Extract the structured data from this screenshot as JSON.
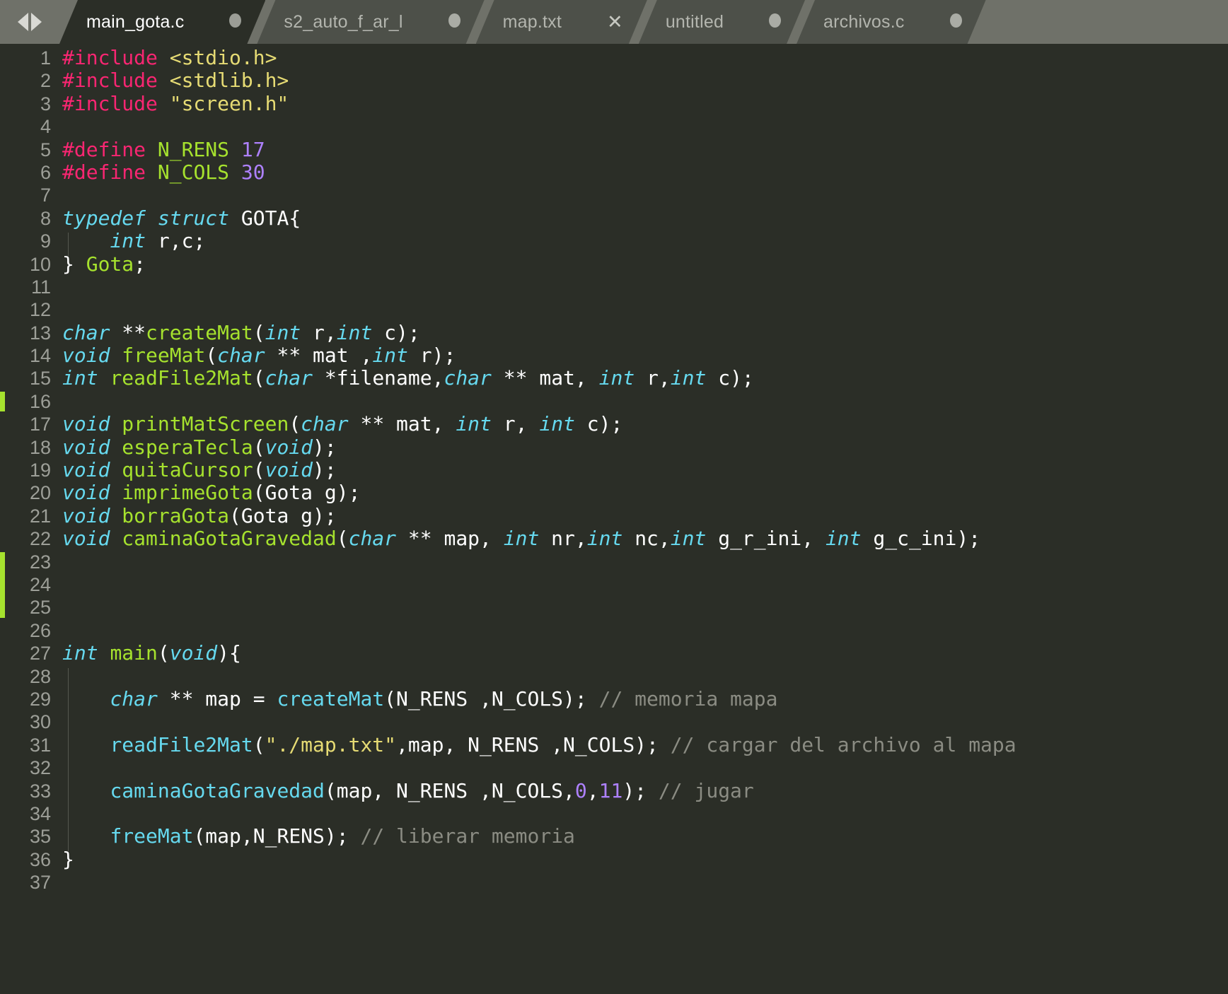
{
  "window": {
    "nav": {
      "prev_label": "◀",
      "next_label": "▶"
    }
  },
  "tabs": [
    {
      "label": "main_gota.c",
      "active": true,
      "mark": "dot",
      "mark_label": "●"
    },
    {
      "label": "s2_auto_f_ar_l",
      "active": false,
      "mark": "dot",
      "mark_label": "●"
    },
    {
      "label": "map.txt",
      "active": false,
      "mark": "close",
      "mark_label": "✕"
    },
    {
      "label": "untitled",
      "active": false,
      "mark": "dot",
      "mark_label": "●"
    },
    {
      "label": "archivos.c",
      "active": false,
      "mark": "dot",
      "mark_label": "●"
    }
  ],
  "editor": {
    "language": "C",
    "first_line": 1,
    "last_line": 37,
    "line_numbers": [
      1,
      2,
      3,
      4,
      5,
      6,
      7,
      8,
      9,
      10,
      11,
      12,
      13,
      14,
      15,
      16,
      17,
      18,
      19,
      20,
      21,
      22,
      23,
      24,
      25,
      26,
      27,
      28,
      29,
      30,
      31,
      32,
      33,
      34,
      35,
      36,
      37
    ],
    "change_marker_lines": [
      16,
      23,
      24,
      25
    ],
    "colors": {
      "background": "#2b2e27",
      "tabbar_background": "#6f7169",
      "inactive_tab": "#4d5049",
      "gutter_text": "#9d9f98",
      "preprocessor": "#f92672",
      "string": "#e6db74",
      "keyword": "#66d9ef",
      "function": "#a6e22e",
      "number": "#ae81ff",
      "comment": "#8b8c83",
      "plain": "#ffffff",
      "change_marker": "#a6e22e"
    },
    "lines": [
      "#include <stdio.h>",
      "#include <stdlib.h>",
      "#include \"screen.h\"",
      "",
      "#define N_RENS 17",
      "#define N_COLS 30",
      "",
      "typedef struct GOTA{",
      "    int r,c;",
      "} Gota;",
      "",
      "",
      "char **createMat(int r,int c);",
      "void freeMat(char ** mat ,int r);",
      "int readFile2Mat(char *filename,char ** mat, int r,int c);",
      "",
      "void printMatScreen(char ** mat, int r, int c);",
      "void esperaTecla(void);",
      "void quitaCursor(void);",
      "void imprimeGota(Gota g);",
      "void borraGota(Gota g);",
      "void caminaGotaGravedad(char ** map, int nr,int nc,int g_r_ini, int g_c_ini);",
      "",
      "",
      "",
      "",
      "int main(void){",
      "",
      "    char ** map = createMat(N_RENS ,N_COLS); // memoria mapa",
      "",
      "    readFile2Mat(\"./map.txt\",map, N_RENS ,N_COLS); // cargar del archivo al mapa",
      "",
      "    caminaGotaGravedad(map, N_RENS ,N_COLS,0,11); // jugar",
      "",
      "    freeMat(map,N_RENS); // liberar memoria",
      "}",
      ""
    ],
    "tokens": [
      [
        [
          "pre",
          "#include"
        ],
        [
          "pln",
          " "
        ],
        [
          "str",
          "<stdio.h>"
        ]
      ],
      [
        [
          "pre",
          "#include"
        ],
        [
          "pln",
          " "
        ],
        [
          "str",
          "<stdlib.h>"
        ]
      ],
      [
        [
          "pre",
          "#include"
        ],
        [
          "pln",
          " "
        ],
        [
          "str",
          "\"screen.h\""
        ]
      ],
      [],
      [
        [
          "pre",
          "#define"
        ],
        [
          "pln",
          " "
        ],
        [
          "mac",
          "N_RENS"
        ],
        [
          "pln",
          " "
        ],
        [
          "num",
          "17"
        ]
      ],
      [
        [
          "pre",
          "#define"
        ],
        [
          "pln",
          " "
        ],
        [
          "mac",
          "N_COLS"
        ],
        [
          "pln",
          " "
        ],
        [
          "num",
          "30"
        ]
      ],
      [],
      [
        [
          "kw",
          "typedef"
        ],
        [
          "pln",
          " "
        ],
        [
          "kw",
          "struct"
        ],
        [
          "pln",
          " GOTA{"
        ]
      ],
      [
        [
          "pln",
          "    "
        ],
        [
          "kw",
          "int"
        ],
        [
          "pln",
          " r,c;"
        ]
      ],
      [
        [
          "pln",
          "} "
        ],
        [
          "fn",
          "Gota"
        ],
        [
          "pln",
          ";"
        ]
      ],
      [],
      [],
      [
        [
          "kw",
          "char"
        ],
        [
          "pln",
          " **"
        ],
        [
          "fn",
          "createMat"
        ],
        [
          "pln",
          "("
        ],
        [
          "kw",
          "int"
        ],
        [
          "pln",
          " r,"
        ],
        [
          "kw",
          "int"
        ],
        [
          "pln",
          " c);"
        ]
      ],
      [
        [
          "kw",
          "void"
        ],
        [
          "pln",
          " "
        ],
        [
          "fn",
          "freeMat"
        ],
        [
          "pln",
          "("
        ],
        [
          "kw",
          "char"
        ],
        [
          "pln",
          " ** mat ,"
        ],
        [
          "kw",
          "int"
        ],
        [
          "pln",
          " r);"
        ]
      ],
      [
        [
          "kw",
          "int"
        ],
        [
          "pln",
          " "
        ],
        [
          "fn",
          "readFile2Mat"
        ],
        [
          "pln",
          "("
        ],
        [
          "kw",
          "char"
        ],
        [
          "pln",
          " *filename,"
        ],
        [
          "kw",
          "char"
        ],
        [
          "pln",
          " ** mat, "
        ],
        [
          "kw",
          "int"
        ],
        [
          "pln",
          " r,"
        ],
        [
          "kw",
          "int"
        ],
        [
          "pln",
          " c);"
        ]
      ],
      [],
      [
        [
          "kw",
          "void"
        ],
        [
          "pln",
          " "
        ],
        [
          "fn",
          "printMatScreen"
        ],
        [
          "pln",
          "("
        ],
        [
          "kw",
          "char"
        ],
        [
          "pln",
          " ** mat, "
        ],
        [
          "kw",
          "int"
        ],
        [
          "pln",
          " r, "
        ],
        [
          "kw",
          "int"
        ],
        [
          "pln",
          " c);"
        ]
      ],
      [
        [
          "kw",
          "void"
        ],
        [
          "pln",
          " "
        ],
        [
          "fn",
          "esperaTecla"
        ],
        [
          "pln",
          "("
        ],
        [
          "kw",
          "void"
        ],
        [
          "pln",
          ");"
        ]
      ],
      [
        [
          "kw",
          "void"
        ],
        [
          "pln",
          " "
        ],
        [
          "fn",
          "quitaCursor"
        ],
        [
          "pln",
          "("
        ],
        [
          "kw",
          "void"
        ],
        [
          "pln",
          ");"
        ]
      ],
      [
        [
          "kw",
          "void"
        ],
        [
          "pln",
          " "
        ],
        [
          "fn",
          "imprimeGota"
        ],
        [
          "pln",
          "(Gota g);"
        ]
      ],
      [
        [
          "kw",
          "void"
        ],
        [
          "pln",
          " "
        ],
        [
          "fn",
          "borraGota"
        ],
        [
          "pln",
          "(Gota g);"
        ]
      ],
      [
        [
          "kw",
          "void"
        ],
        [
          "pln",
          " "
        ],
        [
          "fn",
          "caminaGotaGravedad"
        ],
        [
          "pln",
          "("
        ],
        [
          "kw",
          "char"
        ],
        [
          "pln",
          " ** map, "
        ],
        [
          "kw",
          "int"
        ],
        [
          "pln",
          " nr,"
        ],
        [
          "kw",
          "int"
        ],
        [
          "pln",
          " nc,"
        ],
        [
          "kw",
          "int"
        ],
        [
          "pln",
          " g_r_ini, "
        ],
        [
          "kw",
          "int"
        ],
        [
          "pln",
          " g_c_ini);"
        ]
      ],
      [],
      [],
      [],
      [],
      [
        [
          "kw",
          "int"
        ],
        [
          "pln",
          " "
        ],
        [
          "fn",
          "main"
        ],
        [
          "pln",
          "("
        ],
        [
          "kw",
          "void"
        ],
        [
          "pln",
          "){"
        ]
      ],
      [],
      [
        [
          "pln",
          "    "
        ],
        [
          "kw",
          "char"
        ],
        [
          "pln",
          " ** map = "
        ],
        [
          "call",
          "createMat"
        ],
        [
          "pln",
          "(N_RENS ,N_COLS); "
        ],
        [
          "cmt",
          "// memoria mapa"
        ]
      ],
      [],
      [
        [
          "pln",
          "    "
        ],
        [
          "call",
          "readFile2Mat"
        ],
        [
          "pln",
          "("
        ],
        [
          "str",
          "\"./map.txt\""
        ],
        [
          "pln",
          ",map, N_RENS ,N_COLS); "
        ],
        [
          "cmt",
          "// cargar del archivo al mapa"
        ]
      ],
      [],
      [
        [
          "pln",
          "    "
        ],
        [
          "call",
          "caminaGotaGravedad"
        ],
        [
          "pln",
          "(map, N_RENS ,N_COLS,"
        ],
        [
          "num",
          "0"
        ],
        [
          "pln",
          ","
        ],
        [
          "num",
          "11"
        ],
        [
          "pln",
          "); "
        ],
        [
          "cmt",
          "// jugar"
        ]
      ],
      [],
      [
        [
          "pln",
          "    "
        ],
        [
          "call",
          "freeMat"
        ],
        [
          "pln",
          "(map,N_RENS); "
        ],
        [
          "cmt",
          "// liberar memoria"
        ]
      ],
      [
        [
          "pln",
          "}"
        ]
      ],
      []
    ]
  }
}
